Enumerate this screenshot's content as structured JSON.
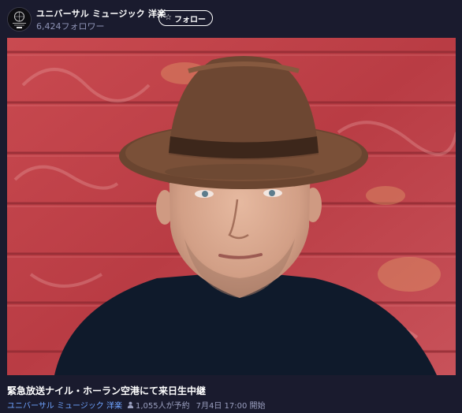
{
  "channel": {
    "name": "ユニバーサル ミュージック 洋楽",
    "followers": "6,424フォロワー",
    "follow_label": "フォロー",
    "follow_icon": "star-icon"
  },
  "program": {
    "title": "緊急放送ナイル・ホーラン空港にて来日生中継",
    "author": "ユニバーサル ミュージック 洋楽",
    "reservations": "1,055人が予約",
    "schedule": "7月4日 17:00 開始"
  },
  "colors": {
    "background": "#1a1b2e",
    "author_link": "#6fa3ff",
    "muted_text": "#9a9fbf",
    "thumbnail_wall": "#c0444a"
  }
}
